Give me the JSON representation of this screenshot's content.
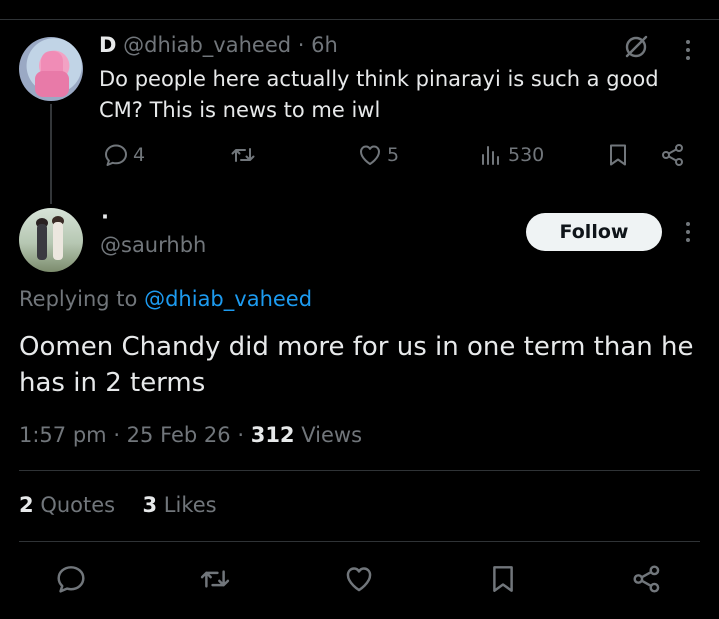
{
  "parent_tweet": {
    "display_name": "D",
    "handle": "@dhiab_vaheed",
    "time": "· 6h",
    "text": "Do people here actually think pinarayi is such a good CM? This is news to me iwl",
    "replies": "4",
    "likes": "5",
    "views": "530"
  },
  "main_tweet": {
    "display_name": "·",
    "handle": "@saurhbh",
    "follow_label": "Follow",
    "replying_prefix": "Replying to",
    "replying_to": "@dhiab_vaheed",
    "text": "Oomen Chandy did more for us in one term than he has in 2 terms",
    "time": "1:57 pm",
    "date": "25 Feb 26",
    "views_count": "312",
    "views_label": "Views",
    "quotes_count": "2",
    "quotes_label": "Quotes",
    "likes_count": "3",
    "likes_label": "Likes"
  },
  "icons": [
    "grok-icon",
    "more-icon",
    "reply-icon",
    "retweet-icon",
    "like-icon",
    "views-icon",
    "bookmark-icon",
    "share-icon"
  ],
  "colors": {
    "background": "#000000",
    "text": "#e7e9ea",
    "secondary": "#71767b",
    "link": "#1d9bf0",
    "divider": "#2f3336"
  }
}
